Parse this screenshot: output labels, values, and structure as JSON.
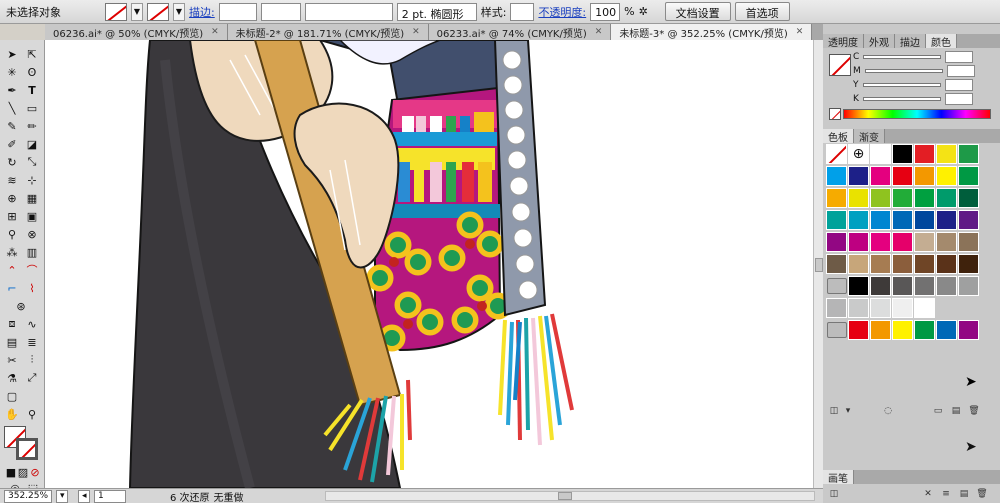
{
  "control_bar": {
    "selection": "未选择对象",
    "stroke_label": "描边:",
    "brush": "2 pt. 椭圆形",
    "style_label": "样式:",
    "opacity_label": "不透明度:",
    "opacity_value": "100",
    "opacity_unit": "%",
    "doc_setup": "文档设置",
    "preferences": "首选项"
  },
  "tabs": [
    {
      "label": "06236.ai* @ 50% (CMYK/预览)"
    },
    {
      "label": "未标题-2* @ 181.71% (CMYK/预览)"
    },
    {
      "label": "06233.ai* @ 74% (CMYK/预览)"
    },
    {
      "label": "未标题-3* @ 352.25% (CMYK/预览)"
    }
  ],
  "status": {
    "zoom": "352.25%",
    "page": "1",
    "undo": "6 次还原",
    "redo": "无重做"
  },
  "panel_top": {
    "tabs": [
      "透明度",
      "外观",
      "描边",
      "颜色"
    ],
    "channels": [
      "C",
      "M",
      "Y",
      "K"
    ]
  },
  "panel_swatches": {
    "tabs": [
      "色板",
      "渐变"
    ]
  },
  "panel_bottom": {
    "tab": "画笔"
  },
  "colors": {
    "accent": "#1a3fbf",
    "hair": "#3a383c",
    "hand": "#efd9bd",
    "stick": "#d6a24f",
    "panel_pink": "#e53887",
    "panel_magenta": "#b5177e",
    "sleeve": "#414f6d"
  }
}
